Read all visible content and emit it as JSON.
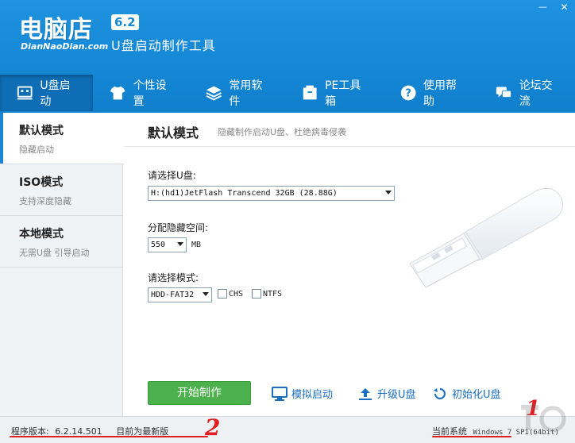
{
  "header": {
    "logo_main": "电脑店",
    "logo_version": "6.2",
    "logo_sub": "DianNaoDian.com",
    "slogan": "U盘启动制作工具",
    "window_controls": {
      "minimize": "—",
      "close": "✕"
    },
    "colors": {
      "header_bg": "#1588d6",
      "active_tab": "#0e6db4"
    }
  },
  "nav": {
    "tabs": [
      {
        "label": "U盘启动",
        "icon": "usb-drive-icon",
        "active": true
      },
      {
        "label": "个性设置",
        "icon": "shirt-icon",
        "active": false
      },
      {
        "label": "常用软件",
        "icon": "layers-icon",
        "active": false
      },
      {
        "label": "PE工具箱",
        "icon": "box-icon",
        "active": false
      },
      {
        "label": "使用帮助",
        "icon": "help-icon",
        "active": false
      },
      {
        "label": "论坛交流",
        "icon": "chat-icon",
        "active": false
      }
    ]
  },
  "sidebar": {
    "items": [
      {
        "title": "默认模式",
        "sub": "隐藏启动",
        "active": true
      },
      {
        "title": "ISO模式",
        "sub": "支持深度隐藏",
        "active": false
      },
      {
        "title": "本地模式",
        "sub": "无需U盘 引导启动",
        "active": false
      }
    ]
  },
  "main": {
    "title": "默认模式",
    "description": "隐藏制作启动U盘、杜绝病毒侵袭",
    "select_disk": {
      "label": "请选择U盘:",
      "value": "H:(hd1)JetFlash Transcend 32GB (28.88G)"
    },
    "hidden_space": {
      "label": "分配隐藏空间:",
      "value": "550",
      "unit": "MB"
    },
    "select_mode": {
      "label": "请选择模式:",
      "value": "HDD-FAT32",
      "chs_label": "CHS",
      "ntfs_label": "NTFS",
      "chs_checked": false,
      "ntfs_checked": false
    },
    "start_button": "开始制作",
    "actions": [
      {
        "label": "模拟启动",
        "icon": "monitor-icon"
      },
      {
        "label": "升级U盘",
        "icon": "upload-icon"
      },
      {
        "label": "初始化U盘",
        "icon": "reset-icon"
      }
    ]
  },
  "status": {
    "version_label": "程序版本:",
    "version_value": "6.2.14.501",
    "latest_text": "目前为最新版",
    "system_label": "当前系统",
    "system_value": "Windows 7 SP1(64bit)"
  },
  "annotations": {
    "one": "1",
    "two": "2",
    "color": "#e02020"
  }
}
